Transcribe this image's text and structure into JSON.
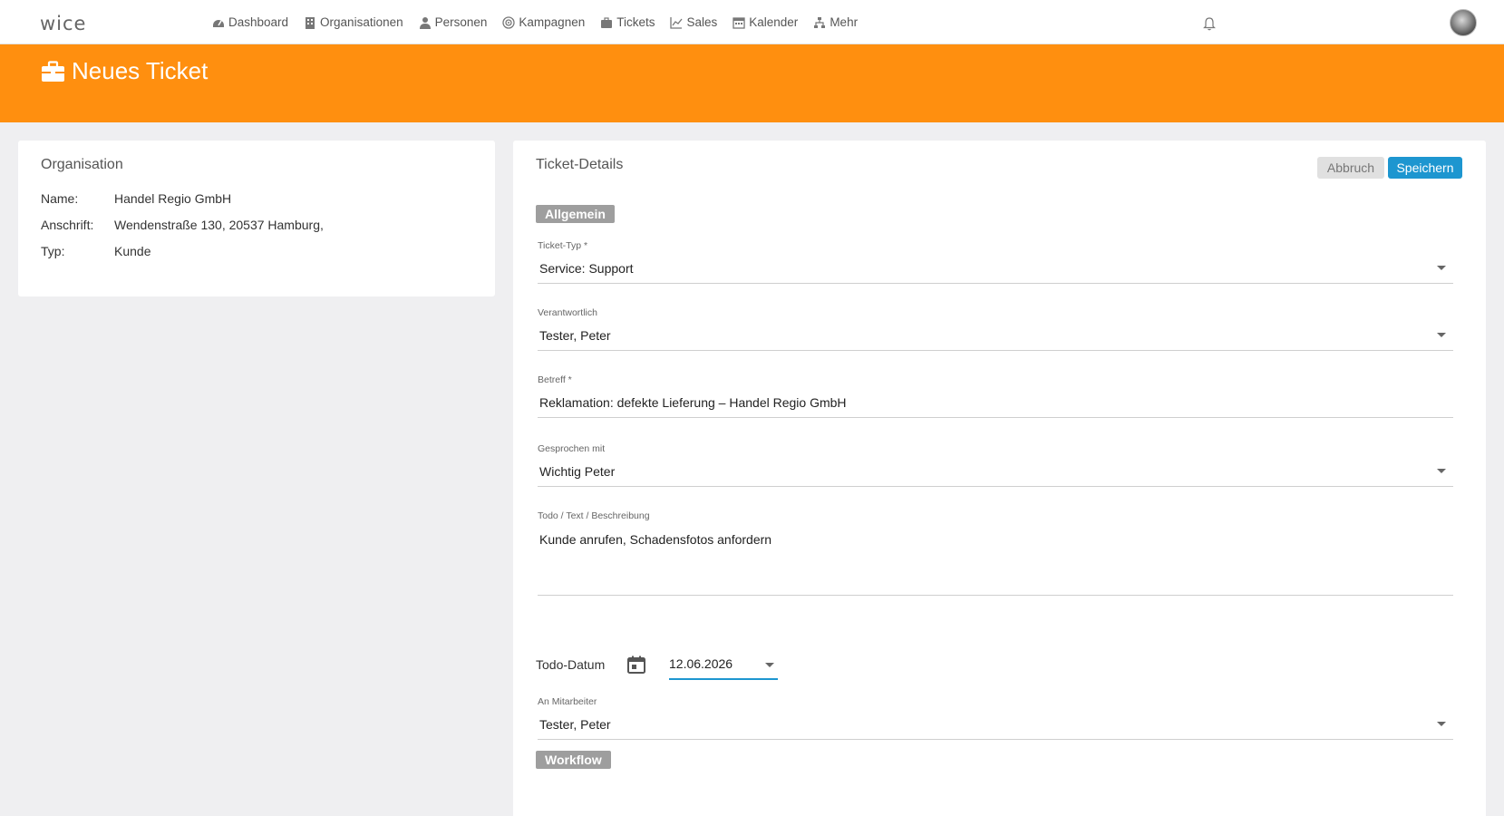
{
  "app": {
    "logo": "wice"
  },
  "nav": [
    {
      "label": "Dashboard",
      "icon": "dashboard-icon"
    },
    {
      "label": "Organisationen",
      "icon": "building-icon"
    },
    {
      "label": "Personen",
      "icon": "person-icon"
    },
    {
      "label": "Kampagnen",
      "icon": "target-icon"
    },
    {
      "label": "Tickets",
      "icon": "briefcase-icon"
    },
    {
      "label": "Sales",
      "icon": "line-chart-icon"
    },
    {
      "label": "Kalender",
      "icon": "calendar-icon"
    },
    {
      "label": "Mehr",
      "icon": "sitemap-icon"
    }
  ],
  "banner": {
    "title": "Neues Ticket",
    "color": "#ff8f0f"
  },
  "organisation": {
    "title": "Organisation",
    "rows": [
      {
        "key": "Name:",
        "value": "Handel Regio GmbH"
      },
      {
        "key": "Anschrift:",
        "value": "Wendenstraße 130, 20537 Hamburg,"
      },
      {
        "key": "Typ:",
        "value": "Kunde"
      }
    ]
  },
  "ticket": {
    "title": "Ticket-Details",
    "cancel_label": "Abbruch",
    "save_label": "Speichern",
    "section_general": "Allgemein",
    "section_workflow": "Workflow",
    "ticket_type": {
      "label": "Ticket-Typ *",
      "value": "Service: Support"
    },
    "responsible": {
      "label": "Verantwortlich",
      "value": "Tester, Peter"
    },
    "subject": {
      "label": "Betreff *",
      "value": "Reklamation: defekte Lieferung – Handel Regio GmbH"
    },
    "spoken_with": {
      "label": "Gesprochen mit",
      "value": "Wichtig Peter"
    },
    "description": {
      "label": "Todo / Text / Beschreibung",
      "value": "Kunde anrufen, Schadensfotos anfordern"
    },
    "todo_date": {
      "label": "Todo-Datum",
      "value": "12.06.2026"
    },
    "assignee": {
      "label": "An Mitarbeiter",
      "value": "Tester, Peter"
    }
  },
  "colors": {
    "accent": "#1d96d0",
    "brand": "#ff8f0f",
    "section_badge": "#9e9e9e"
  }
}
